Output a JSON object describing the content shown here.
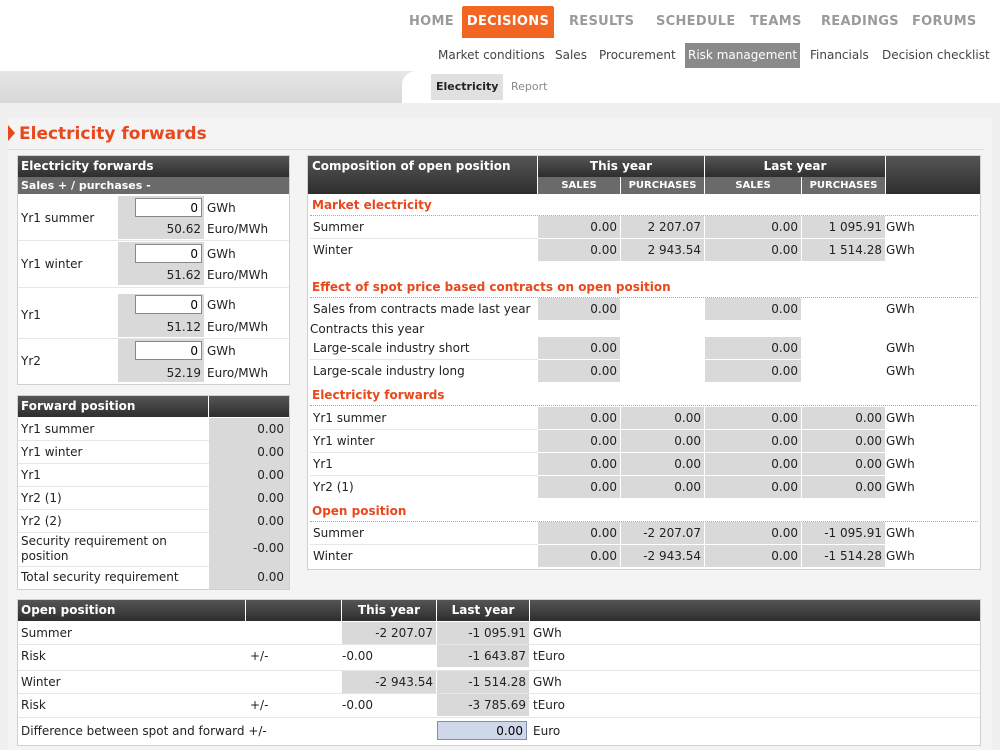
{
  "nav": {
    "items": [
      "HOME",
      "DECISIONS",
      "RESULTS",
      "SCHEDULE",
      "TEAMS",
      "READINGS",
      "FORUMS"
    ],
    "active": "DECISIONS"
  },
  "subnav": {
    "items": [
      "Market conditions",
      "Sales",
      "Procurement",
      "Risk management",
      "Financials",
      "Decision checklist"
    ],
    "active": "Risk management"
  },
  "tabs": [
    "Electricity",
    "Report"
  ],
  "page_title": "Electricity forwards",
  "forwards": {
    "title": "Electricity forwards",
    "subtitle": "Sales + / purchases -",
    "unit_qty": "GWh",
    "unit_price": "Euro/MWh",
    "rows": [
      {
        "label": "Yr1 summer",
        "qty": "0",
        "price": "50.62"
      },
      {
        "label": "Yr1 winter",
        "qty": "0",
        "price": "51.62"
      },
      {
        "label": "Yr1",
        "qty": "0",
        "price": "51.12"
      },
      {
        "label": "Yr2",
        "qty": "0",
        "price": "52.19"
      }
    ]
  },
  "forward_position": {
    "title": "Forward position",
    "rows": [
      {
        "label": "Yr1 summer",
        "value": "0.00"
      },
      {
        "label": "Yr1 winter",
        "value": "0.00"
      },
      {
        "label": "Yr1",
        "value": "0.00"
      },
      {
        "label": "Yr2 (1)",
        "value": "0.00"
      },
      {
        "label": "Yr2 (2)",
        "value": "0.00"
      },
      {
        "label": "Security requirement on position",
        "value": "-0.00"
      },
      {
        "label": "Total security requirement",
        "value": "0.00"
      }
    ]
  },
  "composition": {
    "title": "Composition of open position",
    "this_year": "This year",
    "last_year": "Last year",
    "sales": "SALES",
    "purchases": "PURCHASES",
    "market": {
      "title": "Market electricity",
      "rows": [
        {
          "label": "Summer",
          "s1": "0.00",
          "p1": "2 207.07",
          "s2": "0.00",
          "p2": "1 095.91",
          "unit": "GWh"
        },
        {
          "label": "Winter",
          "s1": "0.00",
          "p1": "2 943.54",
          "s2": "0.00",
          "p2": "1 514.28",
          "unit": "GWh"
        }
      ]
    },
    "spot": {
      "title": "Effect of spot price based contracts on open position",
      "sales_row": {
        "label": "Sales from contracts made last year",
        "s1": "0.00",
        "s2": "0.00",
        "unit": "GWh"
      },
      "contracts_label": "Contracts this year",
      "rows": [
        {
          "label": "Large-scale industry short",
          "s1": "0.00",
          "s2": "0.00",
          "unit": "GWh"
        },
        {
          "label": "Large-scale industry long",
          "s1": "0.00",
          "s2": "0.00",
          "unit": "GWh"
        }
      ]
    },
    "forwards": {
      "title": "Electricity forwards",
      "rows": [
        {
          "label": "Yr1 summer",
          "s1": "0.00",
          "p1": "0.00",
          "s2": "0.00",
          "p2": "0.00",
          "unit": "GWh"
        },
        {
          "label": "Yr1 winter",
          "s1": "0.00",
          "p1": "0.00",
          "s2": "0.00",
          "p2": "0.00",
          "unit": "GWh"
        },
        {
          "label": "Yr1",
          "s1": "0.00",
          "p1": "0.00",
          "s2": "0.00",
          "p2": "0.00",
          "unit": "GWh"
        },
        {
          "label": "Yr2 (1)",
          "s1": "0.00",
          "p1": "0.00",
          "s2": "0.00",
          "p2": "0.00",
          "unit": "GWh"
        }
      ]
    },
    "open": {
      "title": "Open position",
      "rows": [
        {
          "label": "Summer",
          "s1": "0.00",
          "p1": "-2 207.07",
          "s2": "0.00",
          "p2": "-1 095.91",
          "unit": "GWh"
        },
        {
          "label": "Winter",
          "s1": "0.00",
          "p1": "-2 943.54",
          "s2": "0.00",
          "p2": "-1 514.28",
          "unit": "GWh"
        }
      ]
    }
  },
  "open_position": {
    "title": "Open position",
    "this_year": "This year",
    "last_year": "Last year",
    "rows": [
      {
        "label": "Summer",
        "pm": "",
        "ty": "-2 207.07",
        "ly": "-1 095.91",
        "unit": "GWh"
      },
      {
        "label": "Risk",
        "pm": "+/-",
        "ty": "-0.00",
        "ly": "-1 643.87",
        "unit": "tEuro"
      },
      {
        "label": "Winter",
        "pm": "",
        "ty": "-2 943.54",
        "ly": "-1 514.28",
        "unit": "GWh"
      },
      {
        "label": "Risk",
        "pm": "+/-",
        "ty": "-0.00",
        "ly": "-3 785.69",
        "unit": "tEuro"
      }
    ],
    "difference": {
      "label": "Difference between spot and forward +/-",
      "value": "0.00",
      "unit": "Euro"
    }
  },
  "colors": {
    "accent": "#f26522",
    "title": "#e8481c",
    "header": "#3a3a3a"
  }
}
